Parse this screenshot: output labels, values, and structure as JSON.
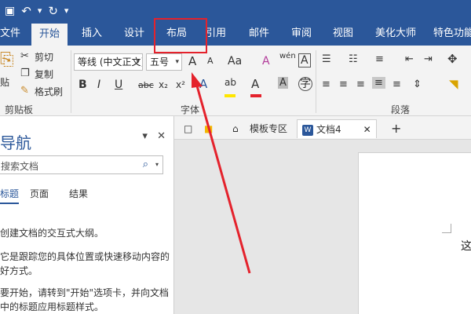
{
  "quick_access": {
    "undo": "↶",
    "redo": "↻",
    "dropdown": "▾"
  },
  "tabs": [
    {
      "label": "文件"
    },
    {
      "label": "开始"
    },
    {
      "label": "插入"
    },
    {
      "label": "设计"
    },
    {
      "label": "布局"
    },
    {
      "label": "引用"
    },
    {
      "label": "邮件"
    },
    {
      "label": "审阅"
    },
    {
      "label": "视图"
    },
    {
      "label": "美化大师"
    },
    {
      "label": "特色功能"
    }
  ],
  "clipboard": {
    "paste": "贴",
    "cut": "剪切",
    "copy": "复制",
    "format_painter": "格式刷",
    "group_label": "剪贴板"
  },
  "font": {
    "font_name": "等线 (中文正文)",
    "font_size": "五号",
    "grow": "A",
    "shrink": "A",
    "change_case": "Aa",
    "clear_format": "A",
    "phonetic": "wén",
    "border_char": "A",
    "bold": "B",
    "italic": "I",
    "underline": "U",
    "strike": "abc",
    "subscript": "x₂",
    "superscript": "x²",
    "text_effect": "A",
    "highlight": "ab",
    "font_color": "A",
    "shading": "A",
    "group_label": "字体",
    "highlight_color": "#ffe600",
    "font_color_value": "#e4222c"
  },
  "paragraph": {
    "group_label": "段落"
  },
  "nav": {
    "title": "导航",
    "search_placeholder": "搜索文档",
    "tabs": [
      "标题",
      "页面",
      "结果"
    ],
    "paragraphs": [
      "创建文档的交互式大纲。",
      "它是跟踪您的具体位置或快速移动内容的",
      "好方式。",
      "要开始，请转到\"开始\"选项卡，并向文档",
      "中的标题应用标题样式。"
    ]
  },
  "doc_tabs": {
    "template": "模板专区",
    "document": "文档4",
    "word_badge": "W",
    "close": "✕",
    "add": "+"
  },
  "page": {
    "text": "这"
  },
  "annotation": {
    "color": "#e4222c"
  },
  "colors": {
    "brand": "#2b579a",
    "ribbon": "#f3f3f3"
  }
}
